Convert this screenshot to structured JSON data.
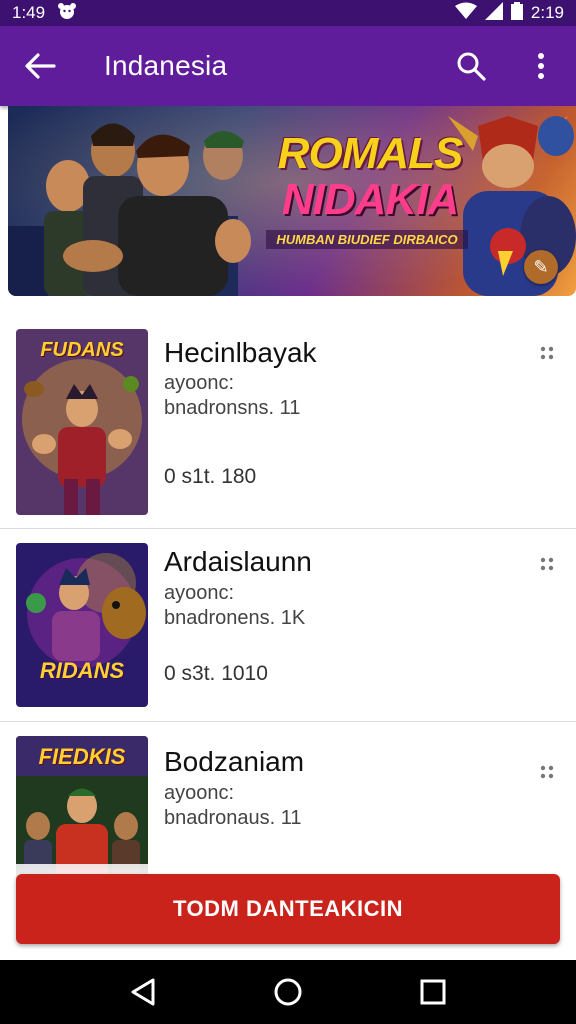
{
  "status_bar": {
    "time_left": "1:49",
    "time_right": "2:19"
  },
  "app_bar": {
    "title": "Indanesia",
    "icons": {
      "back": "back-arrow-icon",
      "search": "search-icon",
      "more": "more-vert-icon"
    }
  },
  "banner": {
    "title_line1": "ROMALS",
    "title_line2": "NIDAKIA",
    "subtitle": "HUMBAN BIUDIEF DIRBAICO"
  },
  "items": [
    {
      "title": "Hecinlbayak",
      "sub1": "ayoonc:",
      "sub2": "bnadronsns. 11",
      "meta": "0 s1t. 180",
      "thumb_label": "FUDANS",
      "thumb_colors": [
        "#1a3a8a",
        "#c8322a",
        "#f0b020"
      ]
    },
    {
      "title": "Ardaislaunn",
      "sub1": "ayoonc:",
      "sub2": "bnadronens. 1K",
      "meta": "0 s3t. 1010",
      "thumb_label": "RIDANS",
      "thumb_colors": [
        "#2a1a6a",
        "#8a2a9a",
        "#f0c020"
      ]
    },
    {
      "title": "Bodzaniam",
      "sub1": "ayoonc:",
      "sub2": "bnadronaus. 11",
      "meta": "",
      "thumb_label": "FIEDKIS",
      "thumb_colors": [
        "#203a20",
        "#c83020",
        "#f0b020"
      ]
    }
  ],
  "cta": {
    "label": "TODM DANTEAKICIN",
    "color": "#c9231c"
  },
  "colors": {
    "status_bar": "#3d1170",
    "app_bar": "#5f1d9c"
  },
  "nav_icons": [
    "nav-back-icon",
    "nav-home-icon",
    "nav-recents-icon"
  ]
}
